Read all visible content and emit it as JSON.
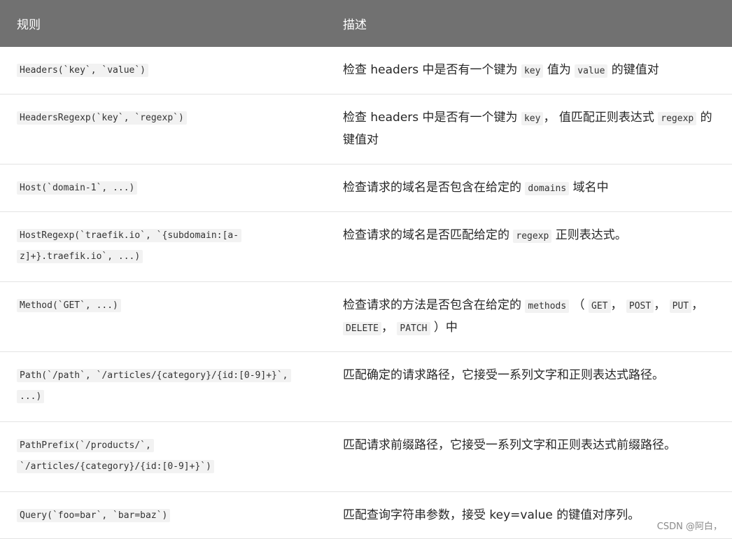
{
  "header": {
    "col_rule": "规则",
    "col_desc": "描述"
  },
  "rows": [
    {
      "rule_lines": [
        "Headers(`key`, `value`)"
      ],
      "desc": [
        {
          "t": "text",
          "v": "检查 headers 中是否有一个键为 "
        },
        {
          "t": "code",
          "v": "key"
        },
        {
          "t": "text",
          "v": " 值为 "
        },
        {
          "t": "code",
          "v": "value"
        },
        {
          "t": "text",
          "v": " 的键值对"
        }
      ]
    },
    {
      "rule_lines": [
        "HeadersRegexp(`key`, `regexp`)"
      ],
      "desc": [
        {
          "t": "text",
          "v": "检查 headers 中是否有一个键为 "
        },
        {
          "t": "code",
          "v": "key"
        },
        {
          "t": "text",
          "v": "， 值匹配正则表达式 "
        },
        {
          "t": "code",
          "v": "regexp"
        },
        {
          "t": "text",
          "v": " 的键值对"
        }
      ]
    },
    {
      "rule_lines": [
        "Host(`domain-1`, ...)"
      ],
      "desc": [
        {
          "t": "text",
          "v": "检查请求的域名是否包含在给定的 "
        },
        {
          "t": "code",
          "v": "domains"
        },
        {
          "t": "text",
          "v": " 域名中"
        }
      ]
    },
    {
      "rule_lines": [
        "HostRegexp(`traefik.io`, `{subdomain:[a-",
        "z]+}.traefik.io`, ...)"
      ],
      "desc": [
        {
          "t": "text",
          "v": "检查请求的域名是否匹配给定的 "
        },
        {
          "t": "code",
          "v": "regexp"
        },
        {
          "t": "text",
          "v": " 正则表达式。"
        }
      ]
    },
    {
      "rule_lines": [
        "Method(`GET`, ...)"
      ],
      "desc": [
        {
          "t": "text",
          "v": "检查请求的方法是否包含在给定的 "
        },
        {
          "t": "code",
          "v": "methods"
        },
        {
          "t": "text",
          "v": " （ "
        },
        {
          "t": "code",
          "v": "GET"
        },
        {
          "t": "text",
          "v": "， "
        },
        {
          "t": "code",
          "v": "POST"
        },
        {
          "t": "text",
          "v": "， "
        },
        {
          "t": "code",
          "v": "PUT"
        },
        {
          "t": "text",
          "v": "， "
        },
        {
          "t": "code",
          "v": "DELETE"
        },
        {
          "t": "text",
          "v": "， "
        },
        {
          "t": "code",
          "v": "PATCH"
        },
        {
          "t": "text",
          "v": " ）中"
        }
      ]
    },
    {
      "rule_lines": [
        "Path(`/path`, `/articles/{category}/{id:[0-9]+}`,",
        "...)"
      ],
      "desc": [
        {
          "t": "text",
          "v": "匹配确定的请求路径，它接受一系列文字和正则表达式路径。"
        }
      ]
    },
    {
      "rule_lines": [
        "PathPrefix(`/products/`,",
        "`/articles/{category}/{id:[0-9]+}`)"
      ],
      "desc": [
        {
          "t": "text",
          "v": "匹配请求前缀路径，它接受一系列文字和正则表达式前缀路径。"
        }
      ]
    },
    {
      "rule_lines": [
        "Query(`foo=bar`, `bar=baz`)"
      ],
      "desc": [
        {
          "t": "text",
          "v": "匹配查询字符串参数，接受 key=value 的键值对序列。"
        }
      ]
    }
  ],
  "watermark": "CSDN @阿白，"
}
